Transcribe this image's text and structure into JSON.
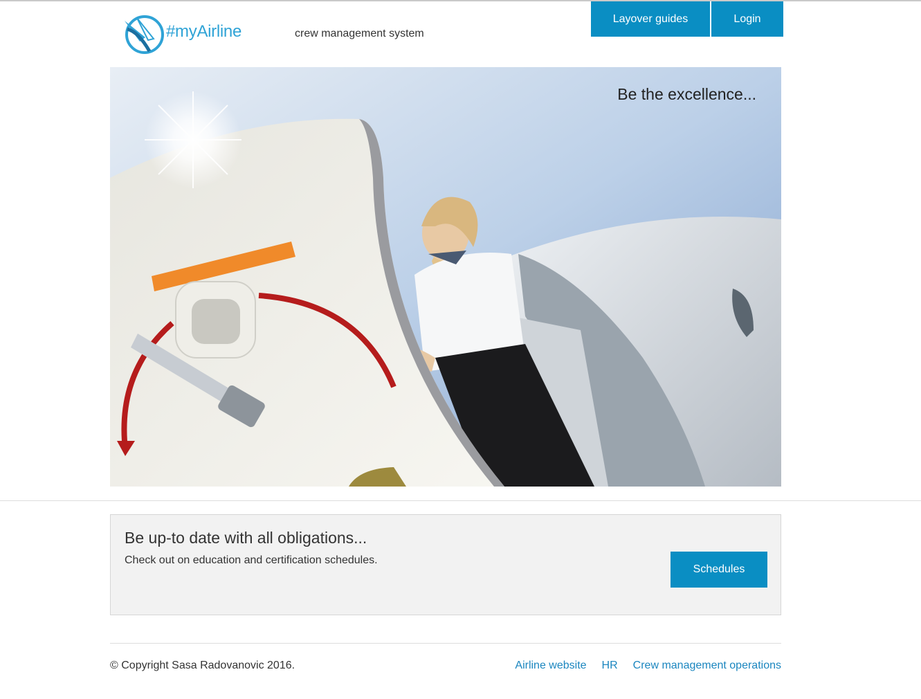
{
  "header": {
    "logo_text": "#myAirline",
    "tagline": "crew management system",
    "nav": {
      "layover_label": "Layover guides",
      "login_label": "Login"
    }
  },
  "hero": {
    "tagline": "Be the excellence..."
  },
  "panel": {
    "title": "Be up-to date with all obligations...",
    "text": "Check out on education and certification schedules.",
    "button_label": "Schedules"
  },
  "footer": {
    "copyright": "© Copyright Sasa Radovanovic 2016.",
    "links": [
      "Airline website",
      "HR",
      "Crew management operations"
    ]
  },
  "colors": {
    "accent": "#0a8ec3",
    "link": "#1b86bf",
    "logo": "#2fa3d6"
  }
}
